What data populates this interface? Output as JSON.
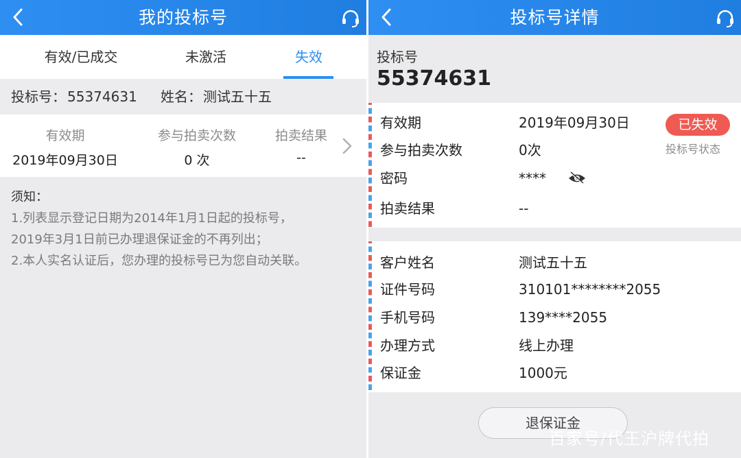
{
  "left": {
    "header": {
      "title": "我的投标号"
    },
    "tabs": [
      {
        "label": "有效/已成交",
        "active": false
      },
      {
        "label": "未激活",
        "active": false
      },
      {
        "label": "失效",
        "active": true
      }
    ],
    "id_bar": {
      "bid_label": "投标号：",
      "bid_number": "55374631",
      "name_label": "姓名：",
      "name": "测试五十五"
    },
    "card": {
      "validity_header": "有效期",
      "validity_value": "2019年09月30日",
      "count_header": "参与拍卖次数",
      "count_value": "0 次",
      "result_header": "拍卖结果",
      "result_value": "--"
    },
    "notice": {
      "title": "须知：",
      "line1": "1.列表显示登记日期为2014年1月1日起的投标号，",
      "line2": "2019年3月1日前已办理退保证金的不再列出；",
      "line3": "2.本人实名认证后，您办理的投标号已为您自动关联。"
    }
  },
  "right": {
    "header": {
      "title": "投标号详情"
    },
    "bid_label": "投标号",
    "bid_number": "55374631",
    "status_badge": "已失效",
    "status_caption": "投标号状态",
    "details": [
      {
        "key": "有效期",
        "value": "2019年09月30日"
      },
      {
        "key": "参与拍卖次数",
        "value": "0次"
      },
      {
        "key": "密码",
        "value": "****"
      },
      {
        "key": "拍卖结果",
        "value": "--"
      }
    ],
    "customer": [
      {
        "key": "客户姓名",
        "value": "测试五十五"
      },
      {
        "key": "证件号码",
        "value": "310101********2055"
      },
      {
        "key": "手机号码",
        "value": "139****2055"
      },
      {
        "key": "办理方式",
        "value": "线上办理"
      },
      {
        "key": "保证金",
        "value": "1000元"
      }
    ],
    "refund_button": "退保证金"
  },
  "watermark": "百家号/代王沪牌代拍",
  "colors": {
    "header_blue": "#2f8ef2",
    "accent_blue": "#2a8ff0",
    "badge_red": "#ef5a52"
  },
  "icons": {
    "back": "chevron-left-icon",
    "support": "headset-icon",
    "chevron": "chevron-right-icon",
    "eye": "eye-slash-icon"
  }
}
